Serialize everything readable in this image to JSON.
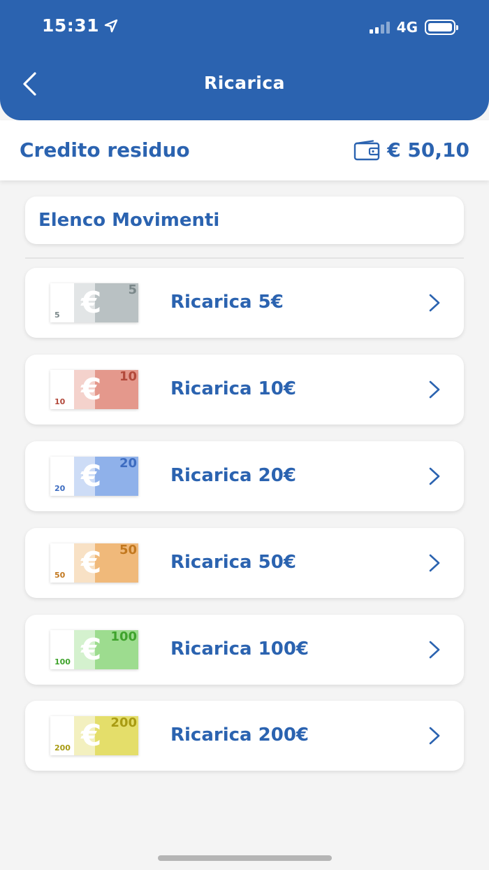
{
  "status_bar": {
    "time": "15:31",
    "network": "4G"
  },
  "header": {
    "title": "Ricarica"
  },
  "credit": {
    "label": "Credito residuo",
    "value": "€ 50,10"
  },
  "movements": {
    "label": "Elenco Movimenti"
  },
  "topups": [
    {
      "label": "Ricarica 5€",
      "note_value": "5",
      "color_main": "#b9c1c3",
      "color_light": "#d8dcde",
      "color_text": "#7a8789"
    },
    {
      "label": "Ricarica 10€",
      "note_value": "10",
      "color_main": "#e4988c",
      "color_light": "#f0c3bb",
      "color_text": "#b2493b"
    },
    {
      "label": "Ricarica 20€",
      "note_value": "20",
      "color_main": "#8fb1ea",
      "color_light": "#bcd0f3",
      "color_text": "#3d6cc0"
    },
    {
      "label": "Ricarica 50€",
      "note_value": "50",
      "color_main": "#f0b97a",
      "color_light": "#f6d7b1",
      "color_text": "#c2781f"
    },
    {
      "label": "Ricarica 100€",
      "note_value": "100",
      "color_main": "#9ddc8f",
      "color_light": "#c6ecbd",
      "color_text": "#3fa32c"
    },
    {
      "label": "Ricarica 200€",
      "note_value": "200",
      "color_main": "#e4de6a",
      "color_light": "#efebaa",
      "color_text": "#a89b13"
    }
  ],
  "colors": {
    "brand": "#2b63b0",
    "background": "#f4f4f4"
  }
}
